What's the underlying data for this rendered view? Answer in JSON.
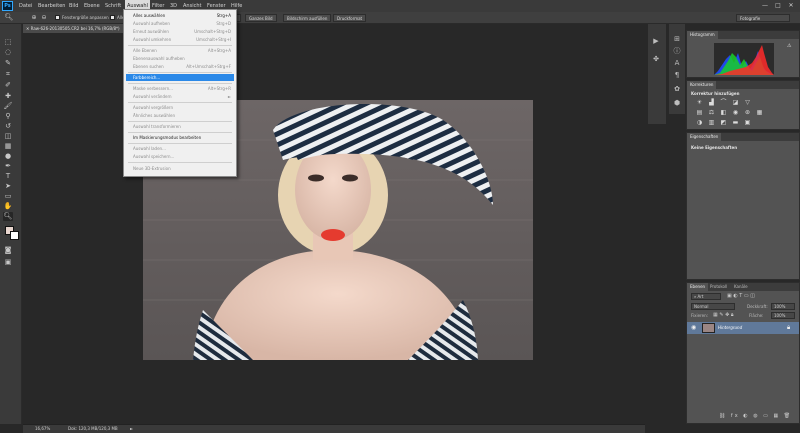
{
  "app": {
    "logo": "Ps"
  },
  "menubar": {
    "items": [
      {
        "label": "Datei"
      },
      {
        "label": "Bearbeiten"
      },
      {
        "label": "Bild"
      },
      {
        "label": "Ebene"
      },
      {
        "label": "Schrift"
      },
      {
        "label": "Auswahl"
      },
      {
        "label": "Filter"
      },
      {
        "label": "3D"
      },
      {
        "label": "Ansicht"
      },
      {
        "label": "Fenster"
      },
      {
        "label": "Hilfe"
      }
    ],
    "window_controls": [
      "—",
      "□",
      "✕"
    ]
  },
  "options": {
    "fit_window_label": "Fenstergröße anpassen",
    "zoom_all_label": "Alle Fenster zoomen",
    "scrubby_label": "Dynamischer Zoom",
    "actual_pixels": "100 %",
    "fit_screen": "Ganzes Bild",
    "fill_screen": "Bildschirm ausfüllen",
    "print_size": "Druckformat",
    "workspace": "Fotografie"
  },
  "document": {
    "tab_title": "Raw-626-20130505.CR2 bei 16,7% (RGB/8*)"
  },
  "statusbar": {
    "zoom": "16,67%",
    "doc_info": "Dok: 120,3 MB/120,3 MB"
  },
  "dropdown": {
    "items": [
      {
        "label": "Alles auswählen",
        "shortcut": "Strg+A",
        "enabled": true
      },
      {
        "label": "Auswahl aufheben",
        "shortcut": "Strg+D",
        "enabled": false
      },
      {
        "label": "Erneut auswählen",
        "shortcut": "Umschalt+Strg+D",
        "enabled": false
      },
      {
        "label": "Auswahl umkehren",
        "shortcut": "Umschalt+Strg+I",
        "enabled": false
      },
      {
        "label": "Alle Ebenen",
        "shortcut": "Alt+Strg+A",
        "enabled": false
      },
      {
        "label": "Ebenenauswahl aufheben",
        "shortcut": "",
        "enabled": false
      },
      {
        "label": "Ebenen suchen",
        "shortcut": "Alt+Umschalt+Strg+F",
        "enabled": false
      },
      {
        "label": "Farbbereich...",
        "shortcut": "",
        "enabled": true,
        "highlighted": true
      },
      {
        "label": "Maske verbessern...",
        "shortcut": "Alt+Strg+R",
        "enabled": false
      },
      {
        "label": "Auswahl verändern",
        "shortcut": "►",
        "enabled": false
      },
      {
        "label": "Auswahl vergrößern",
        "shortcut": "",
        "enabled": false
      },
      {
        "label": "Ähnliches auswählen",
        "shortcut": "",
        "enabled": false
      },
      {
        "label": "Auswahl transformieren",
        "shortcut": "",
        "enabled": false
      },
      {
        "label": "Im Maskierungsmodus bearbeiten",
        "shortcut": "",
        "enabled": true
      },
      {
        "label": "Auswahl laden...",
        "shortcut": "",
        "enabled": false
      },
      {
        "label": "Auswahl speichern...",
        "shortcut": "",
        "enabled": false
      },
      {
        "label": "Neue 3D-Extrusion",
        "shortcut": "",
        "enabled": false
      }
    ]
  },
  "panels": {
    "histogram": {
      "tab": "Histogramm"
    },
    "corrections": {
      "tab": "Korrekturen",
      "title": "Korrektur hinzufügen"
    },
    "properties": {
      "tab": "Eigenschaften",
      "title": "Keine Eigenschaften"
    },
    "layers": {
      "tabs": [
        "Ebenen",
        "Protokoll",
        "Kanäle"
      ],
      "kind_filter": "Art",
      "blend_mode": "Normal",
      "opacity_label": "Deckkraft:",
      "opacity_value": "100%",
      "lock_label": "Fixieren:",
      "fill_label": "Fläche:",
      "fill_value": "100%",
      "layer_name": "Hintergrund"
    }
  },
  "colors": {
    "accent": "#2b89e8",
    "layer_selected": "#60799a"
  }
}
